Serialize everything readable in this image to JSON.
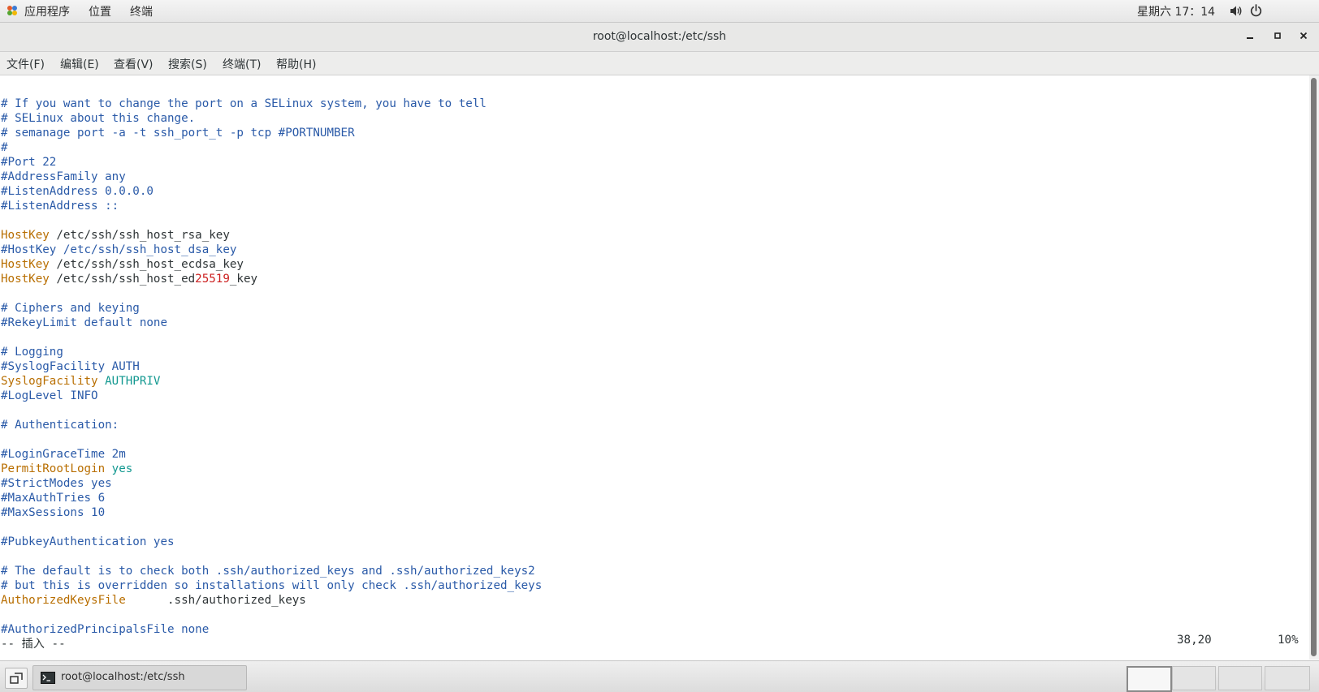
{
  "top_panel": {
    "menus": [
      "应用程序",
      "位置",
      "终端"
    ],
    "clock": "星期六 17：14",
    "icons": [
      "applications-icon",
      "volume-icon",
      "power-icon"
    ]
  },
  "window": {
    "title": "root@localhost:/etc/ssh",
    "buttons": [
      "minimize",
      "maximize",
      "close"
    ]
  },
  "menubar": [
    "文件(F)",
    "编辑(E)",
    "查看(V)",
    "搜索(S)",
    "终端(T)",
    "帮助(H)"
  ],
  "terminal": {
    "lines": [
      [
        [
          "c",
          "# If you want to change the port on a SELinux system, you have to tell"
        ]
      ],
      [
        [
          "c",
          "# SELinux about this change."
        ]
      ],
      [
        [
          "c",
          "# semanage port -a -t ssh_port_t -p tcp #PORTNUMBER"
        ]
      ],
      [
        [
          "c",
          "#"
        ]
      ],
      [
        [
          "c",
          "#Port 22"
        ]
      ],
      [
        [
          "c",
          "#AddressFamily any"
        ]
      ],
      [
        [
          "c",
          "#ListenAddress 0.0.0.0"
        ]
      ],
      [
        [
          "c",
          "#ListenAddress ::"
        ]
      ],
      [],
      [
        [
          "k",
          "HostKey"
        ],
        [
          "n",
          " /etc/ssh/ssh_host_rsa_key"
        ]
      ],
      [
        [
          "c",
          "#HostKey /etc/ssh/ssh_host_dsa_key"
        ]
      ],
      [
        [
          "k",
          "HostKey"
        ],
        [
          "n",
          " /etc/ssh/ssh_host_ecdsa_key"
        ]
      ],
      [
        [
          "k",
          "HostKey"
        ],
        [
          "n",
          " /etc/ssh/ssh_host_ed"
        ],
        [
          "r",
          "25519"
        ],
        [
          "n",
          "_key"
        ]
      ],
      [],
      [
        [
          "c",
          "# Ciphers and keying"
        ]
      ],
      [
        [
          "c",
          "#RekeyLimit default none"
        ]
      ],
      [],
      [
        [
          "c",
          "# Logging"
        ]
      ],
      [
        [
          "c",
          "#SyslogFacility AUTH"
        ]
      ],
      [
        [
          "k",
          "SyslogFacility"
        ],
        [
          "n",
          " "
        ],
        [
          "v",
          "AUTHPRIV"
        ]
      ],
      [
        [
          "c",
          "#LogLevel INFO"
        ]
      ],
      [],
      [
        [
          "c",
          "# Authentication:"
        ]
      ],
      [],
      [
        [
          "c",
          "#LoginGraceTime 2m"
        ]
      ],
      [
        [
          "k",
          "PermitRootLogin"
        ],
        [
          "n",
          " "
        ],
        [
          "v",
          "yes"
        ]
      ],
      [
        [
          "c",
          "#StrictModes yes"
        ]
      ],
      [
        [
          "c",
          "#MaxAuthTries 6"
        ]
      ],
      [
        [
          "c",
          "#MaxSessions 10"
        ]
      ],
      [],
      [
        [
          "c",
          "#PubkeyAuthentication yes"
        ]
      ],
      [],
      [
        [
          "c",
          "# The default is to check both .ssh/authorized_keys and .ssh/authorized_keys2"
        ]
      ],
      [
        [
          "c",
          "# but this is overridden so installations will only check .ssh/authorized_keys"
        ]
      ],
      [
        [
          "k",
          "AuthorizedKeysFile"
        ],
        [
          "n",
          "      .ssh/authorized_keys"
        ]
      ],
      [],
      [
        [
          "c",
          "#AuthorizedPrincipalsFile none"
        ]
      ],
      [
        [
          "n",
          "-- 插入 --"
        ]
      ]
    ],
    "cursor_position": "38,20",
    "scroll_percent": "10%"
  },
  "colors": {
    "comment": "#2a5aa8",
    "keyword": "#b86e00",
    "value": "#129890",
    "number_red": "#cc1f1f",
    "text": "#2e3436"
  },
  "taskbar": {
    "task_label": "root@localhost:/etc/ssh",
    "workspaces": 4,
    "active_workspace": 1
  }
}
